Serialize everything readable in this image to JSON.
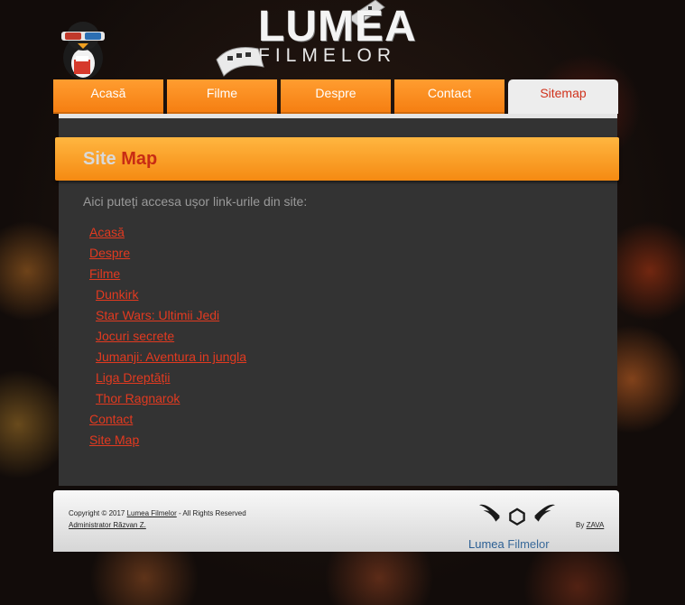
{
  "header": {
    "logo_title": "LUMEA",
    "logo_subtitle": "FILMELOR"
  },
  "nav": {
    "tabs": [
      {
        "label": "Acasă",
        "active": false
      },
      {
        "label": "Filme",
        "active": false
      },
      {
        "label": "Despre",
        "active": false
      },
      {
        "label": "Contact",
        "active": false
      },
      {
        "label": "Sitemap",
        "active": true
      }
    ]
  },
  "page": {
    "title_part1": "Site",
    "title_part2": "Map",
    "intro": "Aici puteți accesa ușor link-urile din site:"
  },
  "sitemap": {
    "links": [
      {
        "label": "Acasă",
        "level": 1
      },
      {
        "label": "Despre",
        "level": 1
      },
      {
        "label": "Filme",
        "level": 1
      },
      {
        "label": "Dunkirk",
        "level": 2
      },
      {
        "label": "Star Wars: Ultimii Jedi",
        "level": 2
      },
      {
        "label": "Jocuri secrete",
        "level": 2
      },
      {
        "label": "Jumanji: Aventura in jungla",
        "level": 2
      },
      {
        "label": "Liga Dreptății",
        "level": 2
      },
      {
        "label": "Thor Ragnarok",
        "level": 2
      },
      {
        "label": "Contact",
        "level": 1
      },
      {
        "label": "Site Map",
        "level": 1
      }
    ]
  },
  "footer": {
    "copyright_prefix": "Copyright © 2017",
    "copyright_link": "Lumea Filmelor",
    "copyright_suffix": "- All Rights Reserved",
    "admin": "Administrator Răzvan Z.",
    "by_label": "By",
    "by_link": "ZAVA",
    "logo_word1": "Lumea",
    "logo_word2": "Filmelor"
  },
  "colors": {
    "accent_orange": "#f57d10",
    "link_red": "#e23a20",
    "panel_bg": "#333333"
  }
}
